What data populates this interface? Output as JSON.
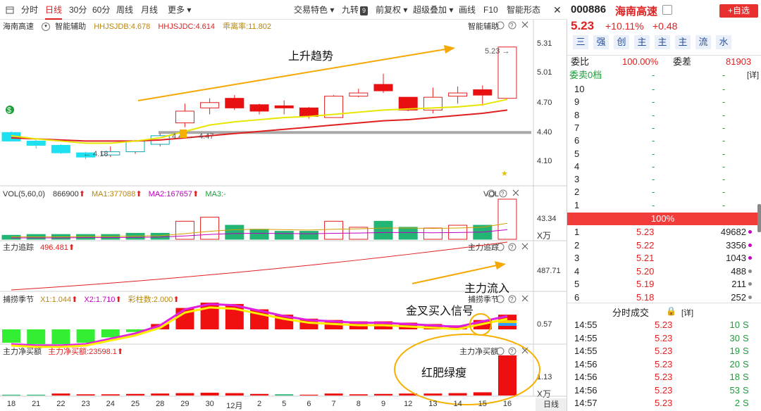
{
  "toolbar": {
    "items": [
      {
        "label": "分时"
      },
      {
        "label": "日线"
      },
      {
        "label": "30分"
      },
      {
        "label": "60分"
      },
      {
        "label": "周线"
      },
      {
        "label": "月线"
      },
      {
        "label": "更多 ▾"
      }
    ],
    "right_items": [
      {
        "label": "交易特色 ▾"
      },
      {
        "label": "九转"
      },
      {
        "label": "前复权 ▾"
      },
      {
        "label": "超级叠加 ▾"
      },
      {
        "label": "画线"
      },
      {
        "label": "F10"
      },
      {
        "label": "智能形态"
      }
    ],
    "jiuzhuan_badge": "9"
  },
  "main_panel": {
    "stock_name": "海南高速",
    "assist": "智能辅助",
    "ind1": "HHJSJDB:4.678",
    "ind2": "HHJSJDC:4.614",
    "ind3": "乖离率:11.802",
    "assist_right": "智能辅助",
    "yticks": [
      "5.31",
      "5.01",
      "4.70",
      "4.40",
      "4.10"
    ],
    "last_price": "5.23",
    "low_label": "4.18",
    "mid_label": "4.47",
    "mid_label2": "4.4"
  },
  "vol_panel": {
    "title": "VOL(5,60,0)",
    "value": "866900",
    "ma1": "MA1:377088",
    "ma2": "MA2:167657",
    "ma3": "MA3:-",
    "right": "VOL",
    "ytick": "43.34",
    "unit": "X万"
  },
  "track_panel": {
    "title": "主力追踪",
    "value": "496.481",
    "right": "主力追踪",
    "ytick": "487.71"
  },
  "season_panel": {
    "title": "捕捞季节",
    "x1": "X1:1.044",
    "x2": "X2:1.710",
    "bars": "彩柱数:2.000",
    "right": "捕捞季节",
    "ytick": "0.57"
  },
  "net_panel": {
    "title": "主力净买额",
    "value": "主力净买额:23598.1",
    "right": "主力净买额",
    "ytick": "1.13",
    "unit": "X万"
  },
  "xaxis": {
    "labels": [
      "18",
      "21",
      "22",
      "23",
      "24",
      "25",
      "28",
      "29",
      "30",
      "12月",
      "2",
      "5",
      "6",
      "7",
      "8",
      "9",
      "12",
      "13",
      "14",
      "15",
      "16"
    ],
    "period": "日线"
  },
  "annotations": {
    "trend_up": "上升趋势",
    "inflow": "主力流入",
    "golden_cross": "金叉买入信号",
    "red_green": "红肥绿瘦"
  },
  "chart_data": {
    "type": "candlestick",
    "categories": [
      "18",
      "21",
      "22",
      "23",
      "24",
      "25",
      "28",
      "29",
      "30",
      "12月",
      "2",
      "5",
      "6",
      "7",
      "8",
      "9",
      "12",
      "13",
      "14",
      "15",
      "16"
    ],
    "candles": [
      {
        "o": 4.43,
        "h": 4.44,
        "l": 4.35,
        "c": 4.35,
        "dir": "down"
      },
      {
        "o": 4.35,
        "h": 4.36,
        "l": 4.28,
        "c": 4.31,
        "dir": "down"
      },
      {
        "o": 4.31,
        "h": 4.32,
        "l": 4.23,
        "c": 4.24,
        "dir": "down"
      },
      {
        "o": 4.24,
        "h": 4.25,
        "l": 4.18,
        "c": 4.2,
        "dir": "down"
      },
      {
        "o": 4.22,
        "h": 4.3,
        "l": 4.2,
        "c": 4.25,
        "dir": "up"
      },
      {
        "o": 4.25,
        "h": 4.36,
        "l": 4.23,
        "c": 4.35,
        "dir": "up"
      },
      {
        "o": 4.32,
        "h": 4.42,
        "l": 4.3,
        "c": 4.4,
        "dir": "up"
      },
      {
        "o": 4.52,
        "h": 4.7,
        "l": 4.48,
        "c": 4.63,
        "dir": "up"
      },
      {
        "o": 4.66,
        "h": 4.75,
        "l": 4.6,
        "c": 4.71,
        "dir": "up"
      },
      {
        "o": 4.75,
        "h": 4.78,
        "l": 4.64,
        "c": 4.66,
        "dir": "down"
      },
      {
        "o": 4.69,
        "h": 4.7,
        "l": 4.6,
        "c": 4.63,
        "dir": "down"
      },
      {
        "o": 4.68,
        "h": 4.73,
        "l": 4.6,
        "c": 4.66,
        "dir": "down"
      },
      {
        "o": 4.66,
        "h": 4.67,
        "l": 4.56,
        "c": 4.58,
        "dir": "down"
      },
      {
        "o": 4.57,
        "h": 4.78,
        "l": 4.57,
        "c": 4.77,
        "dir": "up"
      },
      {
        "o": 4.77,
        "h": 4.84,
        "l": 4.76,
        "c": 4.8,
        "dir": "up"
      },
      {
        "o": 4.88,
        "h": 4.98,
        "l": 4.8,
        "c": 4.82,
        "dir": "down"
      },
      {
        "o": 4.76,
        "h": 4.76,
        "l": 4.63,
        "c": 4.64,
        "dir": "down"
      },
      {
        "o": 4.64,
        "h": 4.85,
        "l": 4.61,
        "c": 4.76,
        "dir": "up"
      },
      {
        "o": 4.77,
        "h": 4.86,
        "l": 4.7,
        "c": 4.8,
        "dir": "up"
      },
      {
        "o": 4.78,
        "h": 4.87,
        "l": 4.68,
        "c": 4.83,
        "dir": "down"
      },
      {
        "o": 4.75,
        "h": 5.23,
        "l": 4.75,
        "c": 5.23,
        "dir": "up"
      }
    ],
    "volume_relative": [
      0.1,
      0.12,
      0.12,
      0.12,
      0.12,
      0.15,
      0.15,
      0.45,
      0.55,
      0.35,
      0.25,
      0.2,
      0.2,
      0.45,
      0.3,
      0.45,
      0.3,
      0.28,
      0.35,
      0.35,
      1.0
    ],
    "season_bars": [
      -0.5,
      -0.55,
      -0.55,
      -0.5,
      -0.3,
      -0.1,
      0.2,
      0.8,
      1.0,
      0.95,
      0.75,
      0.55,
      0.4,
      0.35,
      0.3,
      0.3,
      0.25,
      0.2,
      0.15,
      0.35,
      0.55
    ],
    "net_bars": [
      0.02,
      0.02,
      0.05,
      0.03,
      0.03,
      0.04,
      0.05,
      0.06,
      0.07,
      0.06,
      0.04,
      0.03,
      0.02,
      0.05,
      0.03,
      0.04,
      0.05,
      0.05,
      0.06,
      0.08,
      1.0
    ]
  },
  "sidebar": {
    "code": "000886",
    "name": "海南高速",
    "add_btn": "+自选",
    "price": "5.23",
    "pct": "+10.11%",
    "chg": "+0.48",
    "tags": [
      "三",
      "强",
      "创",
      "主",
      "主",
      "主",
      "流",
      "水"
    ],
    "weibi_label": "委比",
    "weibi_value": "100.00%",
    "weicha_label": "委差",
    "weicha_value": "81903",
    "sell0_label": "委卖0档",
    "sell0_dash1": "-",
    "sell0_dash2": "-",
    "detail": "[详]",
    "sell_levels": [
      {
        "n": "10",
        "p": "-",
        "v": "-"
      },
      {
        "n": "9",
        "p": "-",
        "v": "-"
      },
      {
        "n": "8",
        "p": "-",
        "v": "-"
      },
      {
        "n": "7",
        "p": "-",
        "v": "-"
      },
      {
        "n": "6",
        "p": "-",
        "v": "-"
      },
      {
        "n": "5",
        "p": "-",
        "v": "-"
      },
      {
        "n": "4",
        "p": "-",
        "v": "-"
      },
      {
        "n": "3",
        "p": "-",
        "v": "-"
      },
      {
        "n": "2",
        "p": "-",
        "v": "-"
      },
      {
        "n": "1",
        "p": "-",
        "v": "-"
      }
    ],
    "bar_pct": "100%",
    "buy_levels": [
      {
        "n": "1",
        "p": "5.23",
        "v": "49682"
      },
      {
        "n": "2",
        "p": "5.22",
        "v": "3356"
      },
      {
        "n": "3",
        "p": "5.21",
        "v": "1043"
      },
      {
        "n": "4",
        "p": "5.20",
        "v": "488"
      },
      {
        "n": "5",
        "p": "5.19",
        "v": "211"
      },
      {
        "n": "6",
        "p": "5.18",
        "v": "252"
      }
    ],
    "ticks_title": "分时成交",
    "ticks_detail": "[详]",
    "ticks": [
      {
        "t": "14:55",
        "p": "5.23",
        "v": "10",
        "s": "S"
      },
      {
        "t": "14:55",
        "p": "5.23",
        "v": "30",
        "s": "S"
      },
      {
        "t": "14:55",
        "p": "5.23",
        "v": "19",
        "s": "S"
      },
      {
        "t": "14:56",
        "p": "5.23",
        "v": "20",
        "s": "S"
      },
      {
        "t": "14:56",
        "p": "5.23",
        "v": "18",
        "s": "S"
      },
      {
        "t": "14:56",
        "p": "5.23",
        "v": "53",
        "s": "S"
      },
      {
        "t": "14:57",
        "p": "5.23",
        "v": "2",
        "s": "S"
      }
    ]
  }
}
